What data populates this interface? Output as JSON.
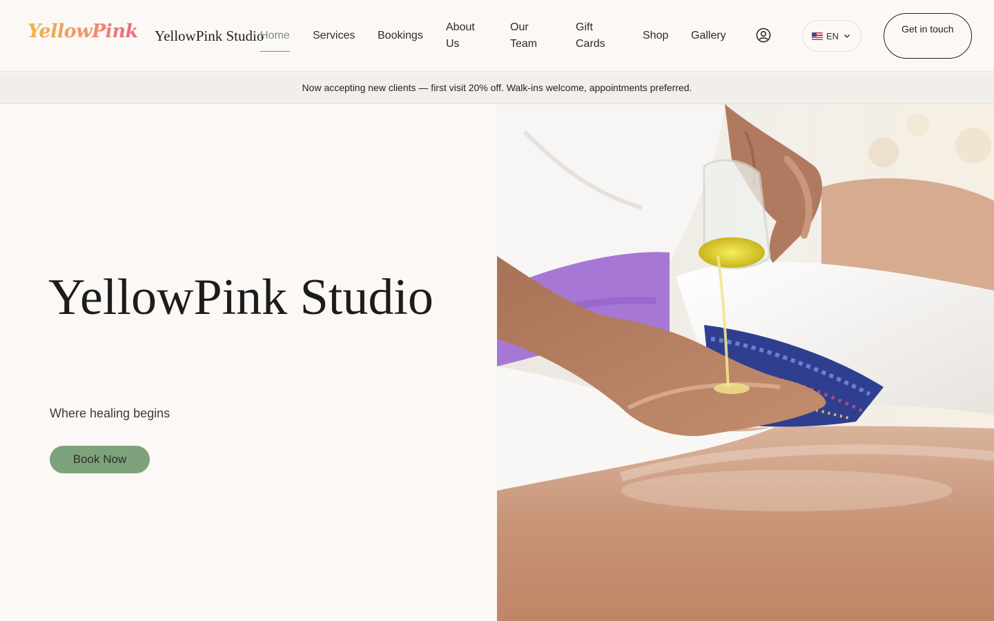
{
  "header": {
    "logo_text": "YellowPink",
    "brand_name": "YellowPink Studio",
    "nav": [
      {
        "label": "Home",
        "active": true
      },
      {
        "label": "Services"
      },
      {
        "label": "Bookings"
      },
      {
        "label": "About\nUs"
      },
      {
        "label": "Our\nTeam"
      },
      {
        "label": "Gift\nCards"
      },
      {
        "label": "Shop"
      },
      {
        "label": "Gallery"
      }
    ],
    "account_icon": "user-circle-icon",
    "language": {
      "flag": "us-flag-icon",
      "code": "EN"
    },
    "cta_label": "Get in touch"
  },
  "banner": {
    "text": "Now accepting new clients — first visit 20% off. Walk-ins welcome, appointments preferred."
  },
  "hero": {
    "title": "YellowPink Studio",
    "subtitle": "Where healing begins",
    "button_label": "Book Now",
    "image": "massage-oil-pouring-photo"
  },
  "colors": {
    "accent_green": "#7ea27b",
    "nav_active": "#7b8f77",
    "background": "#fcf8f5",
    "logo_gradient": [
      "#f0b545",
      "#e86a86"
    ]
  }
}
